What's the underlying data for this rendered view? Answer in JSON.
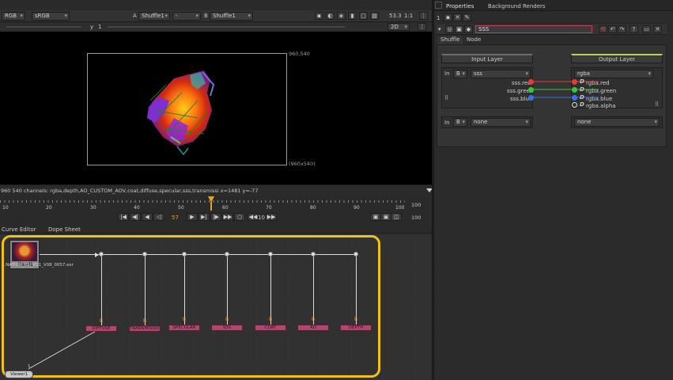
{
  "viewer": {
    "toolbar": {
      "colorspace": "RGB",
      "lut": "sRGB",
      "a_label": "A",
      "a_input": "Shuffle1",
      "ab_mode": "-",
      "b_label": "B",
      "b_input": "Shuffle1",
      "zoom": "53.3",
      "proxy": "1:1",
      "y_label": "y",
      "y_value": "1",
      "view_mode": "2D"
    },
    "format_top": "960,540",
    "format_bottom": "(960x540)",
    "status": "960 540 channels: rgba,depth,AO_CUSTOM_AOV,coat,diffuse,specular,sss,transmissi   x=1481 y=-77"
  },
  "timeline": {
    "ticks": [
      "10",
      "20",
      "30",
      "40",
      "50",
      "60",
      "70",
      "80",
      "90",
      "100"
    ],
    "current_frame": "57",
    "end_frame_top": "100",
    "end_frame_bottom": "100",
    "increment": "10"
  },
  "graph_tabs": [
    "Curve Editor",
    "Dope Sheet"
  ],
  "nodegraph": {
    "read_node": {
      "name": "Read1",
      "file": "...NATION_01_VO1_V08_0057.exr"
    },
    "viewer_node": {
      "name": "Viewer1",
      "input_num": "1"
    },
    "b_label": "B",
    "shuffles": [
      "DIFFUSE",
      "TRANSMISSION",
      "SPECULAR",
      "SSS",
      "COAT",
      "AO",
      "DEPTH"
    ],
    "highlight_color": "#f2c118"
  },
  "properties": {
    "tabs": [
      "Properties",
      "Background Renders"
    ],
    "count": "1",
    "node_name": "SSS",
    "subtabs": [
      "Shuffle",
      "Node"
    ],
    "input_layer_title": "Input Layer",
    "output_layer_title": "Output Layer",
    "in1": {
      "in_label": "In",
      "input": "B",
      "layer": "sss"
    },
    "in2": {
      "in_label": "In",
      "input": "B",
      "layer": "none"
    },
    "out1": {
      "layer": "rgba"
    },
    "out2": {
      "layer": "none"
    },
    "in_channels": [
      "sss.red",
      "sss.green",
      "sss.blue"
    ],
    "out_channels": [
      "rgba.red",
      "rgba.green",
      "rgba.blue",
      "rgba.alpha"
    ],
    "channel_colors": [
      "#e23c3c",
      "#3cc33c",
      "#3c6fe0"
    ]
  }
}
